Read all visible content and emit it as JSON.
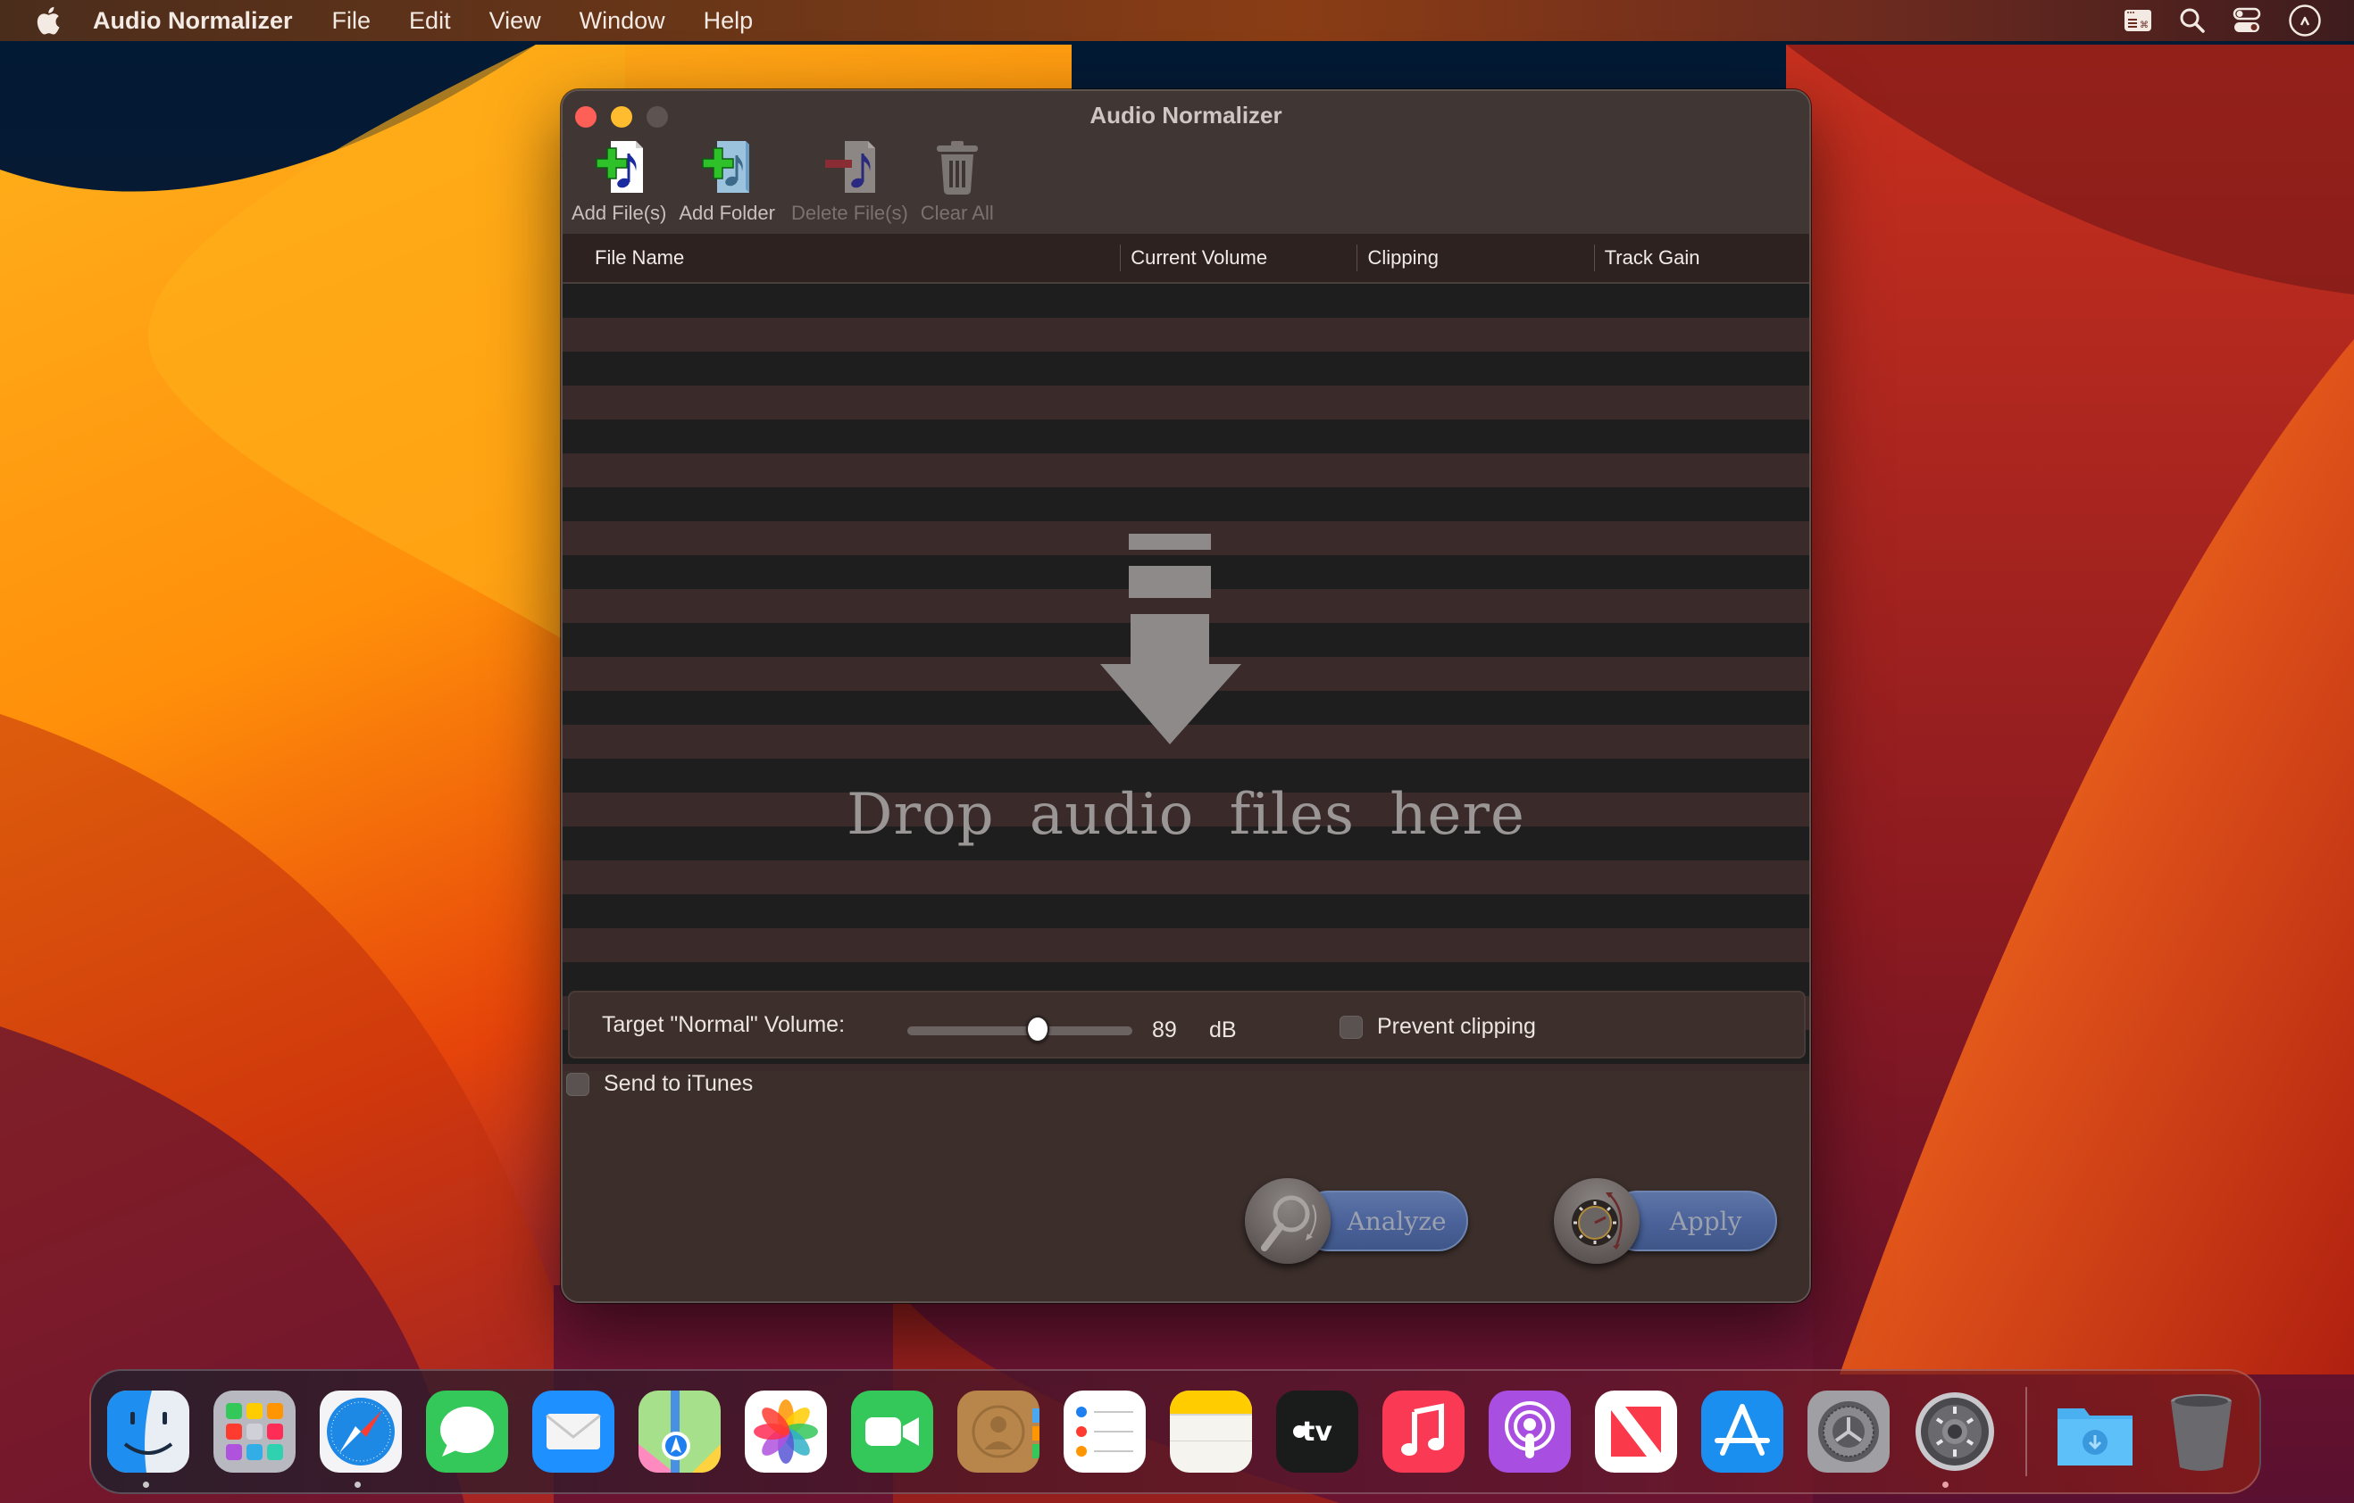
{
  "menubar": {
    "app_name": "Audio Normalizer",
    "items": [
      "File",
      "Edit",
      "View",
      "Window",
      "Help"
    ],
    "status_icons": [
      "keyboard-viewer-icon",
      "spotlight-search-icon",
      "control-center-icon",
      "clock-icon"
    ]
  },
  "window": {
    "title": "Audio Normalizer",
    "toolbar": [
      {
        "label": "Add File(s)",
        "icon": "add-file-icon",
        "enabled": true
      },
      {
        "label": "Add Folder",
        "icon": "add-folder-icon",
        "enabled": true
      },
      {
        "label": "Delete File(s)",
        "icon": "delete-file-icon",
        "enabled": false
      },
      {
        "label": "Clear All",
        "icon": "trash-icon",
        "enabled": false
      }
    ],
    "table": {
      "columns": [
        "File Name",
        "Current Volume",
        "Clipping",
        "Track Gain"
      ],
      "rows": []
    },
    "drop_zone": {
      "text": "Drop audio files here",
      "icon": "download-arrow-icon"
    },
    "settings": {
      "target_label": "Target \"Normal\" Volume:",
      "volume_value": "89",
      "volume_unit": "dB",
      "slider_fraction": 0.58,
      "prevent_clipping_label": "Prevent clipping",
      "prevent_clipping_checked": false,
      "send_to_itunes_label": "Send to iTunes",
      "send_to_itunes_checked": false
    },
    "actions": {
      "analyze_label": "Analyze",
      "apply_label": "Apply"
    }
  },
  "dock": {
    "apps": [
      {
        "name": "Finder",
        "running": true
      },
      {
        "name": "Launchpad",
        "running": false
      },
      {
        "name": "Safari",
        "running": true
      },
      {
        "name": "Messages",
        "running": false
      },
      {
        "name": "Mail",
        "running": false
      },
      {
        "name": "Maps",
        "running": false
      },
      {
        "name": "Photos",
        "running": false
      },
      {
        "name": "FaceTime",
        "running": false
      },
      {
        "name": "Contacts",
        "running": false
      },
      {
        "name": "Reminders",
        "running": false
      },
      {
        "name": "Notes",
        "running": false
      },
      {
        "name": "Apple TV",
        "running": false
      },
      {
        "name": "Music",
        "running": false
      },
      {
        "name": "Podcasts",
        "running": false
      },
      {
        "name": "News",
        "running": false
      },
      {
        "name": "App Store",
        "running": false
      },
      {
        "name": "System Preferences",
        "running": false
      },
      {
        "name": "Audio Normalizer",
        "running": true
      }
    ],
    "others": [
      {
        "name": "Downloads"
      },
      {
        "name": "Trash"
      }
    ]
  },
  "colors": {
    "window_bg": "#3b2e2b",
    "row_dark": "#1f1e1e",
    "row_brown": "#3a2a2a",
    "action_pill": "#4b639a",
    "close": "#fe5f57",
    "minimize": "#febc2e"
  }
}
